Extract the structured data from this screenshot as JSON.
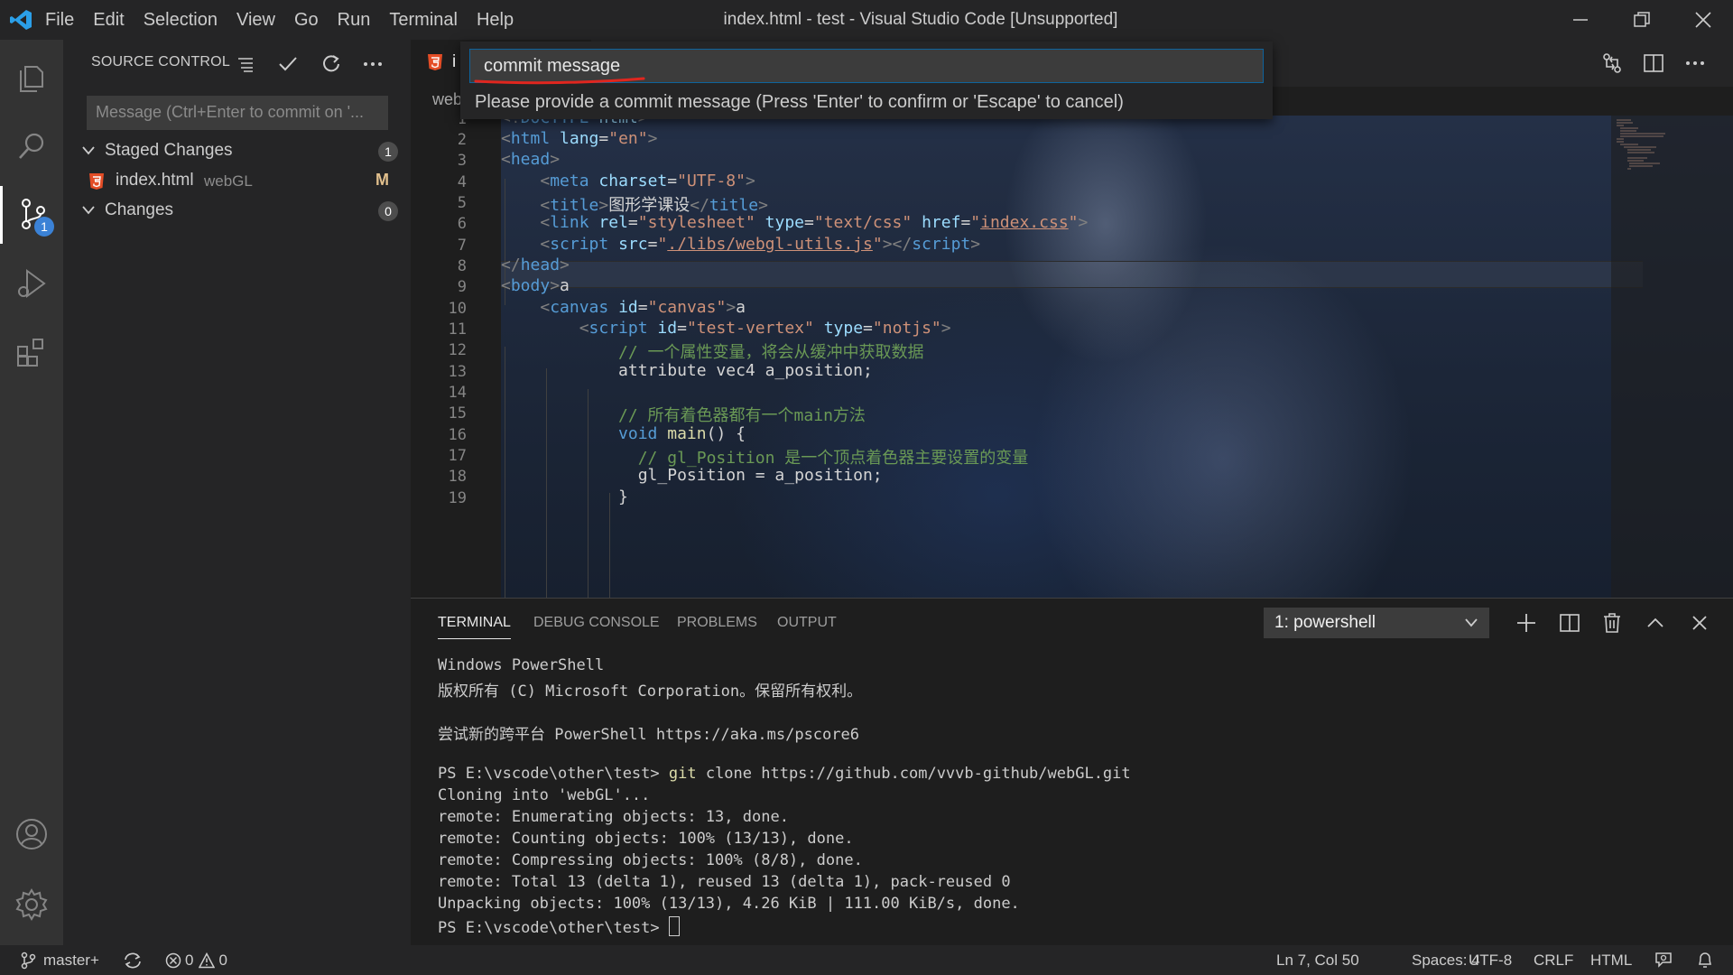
{
  "titlebar": {
    "menu": [
      "File",
      "Edit",
      "Selection",
      "View",
      "Go",
      "Run",
      "Terminal",
      "Help"
    ],
    "window_title": "index.html - test - Visual Studio Code [Unsupported]"
  },
  "activity": {
    "scm_badge": "1"
  },
  "sidebar": {
    "title": "SOURCE CONTROL",
    "message_placeholder": "Message (Ctrl+Enter to commit on '...",
    "staged_label": "Staged Changes",
    "staged_count": "1",
    "file_name": "index.html",
    "file_folder": "webGL",
    "file_status": "M",
    "changes_label": "Changes",
    "changes_count": "0"
  },
  "editor": {
    "tab_label": "i",
    "breadcrumb": "web",
    "line_numbers": [
      "1",
      "2",
      "3",
      "4",
      "5",
      "6",
      "7",
      "8",
      "9",
      "10",
      "11",
      "12",
      "13",
      "14",
      "15",
      "16",
      "17",
      "18",
      "19"
    ]
  },
  "quick_input": {
    "value": "commit message",
    "message": "Please provide a commit message (Press 'Enter' to confirm or 'Escape' to cancel)"
  },
  "panel": {
    "tabs": [
      "TERMINAL",
      "DEBUG CONSOLE",
      "PROBLEMS",
      "OUTPUT"
    ],
    "shell": "1: powershell",
    "terminal_lines": [
      "Windows PowerShell",
      "版权所有 (C) Microsoft Corporation。保留所有权利。",
      "",
      "尝试新的跨平台 PowerShell https://aka.ms/pscore6",
      "",
      "PS E:\\vscode\\other\\test> ",
      "Cloning into 'webGL'...",
      "remote: Enumerating objects: 13, done.",
      "remote: Counting objects: 100% (13/13), done.",
      "remote: Compressing objects: 100% (8/8), done.",
      "remote: Total 13 (delta 1), reused 13 (delta 1), pack-reused 0",
      "Unpacking objects: 100% (13/13), 4.26 KiB | 111.00 KiB/s, done.",
      "PS E:\\vscode\\other\\test> "
    ],
    "git_cmd": "git",
    "git_args": " clone https://github.com/vvvb-github/webGL.git"
  },
  "status": {
    "branch": "master+",
    "errors": "0",
    "warnings": "0",
    "position": "Ln 7, Col 50",
    "spaces": "Spaces: 4",
    "encoding": "UTF-8",
    "eol": "CRLF",
    "language": "HTML"
  }
}
